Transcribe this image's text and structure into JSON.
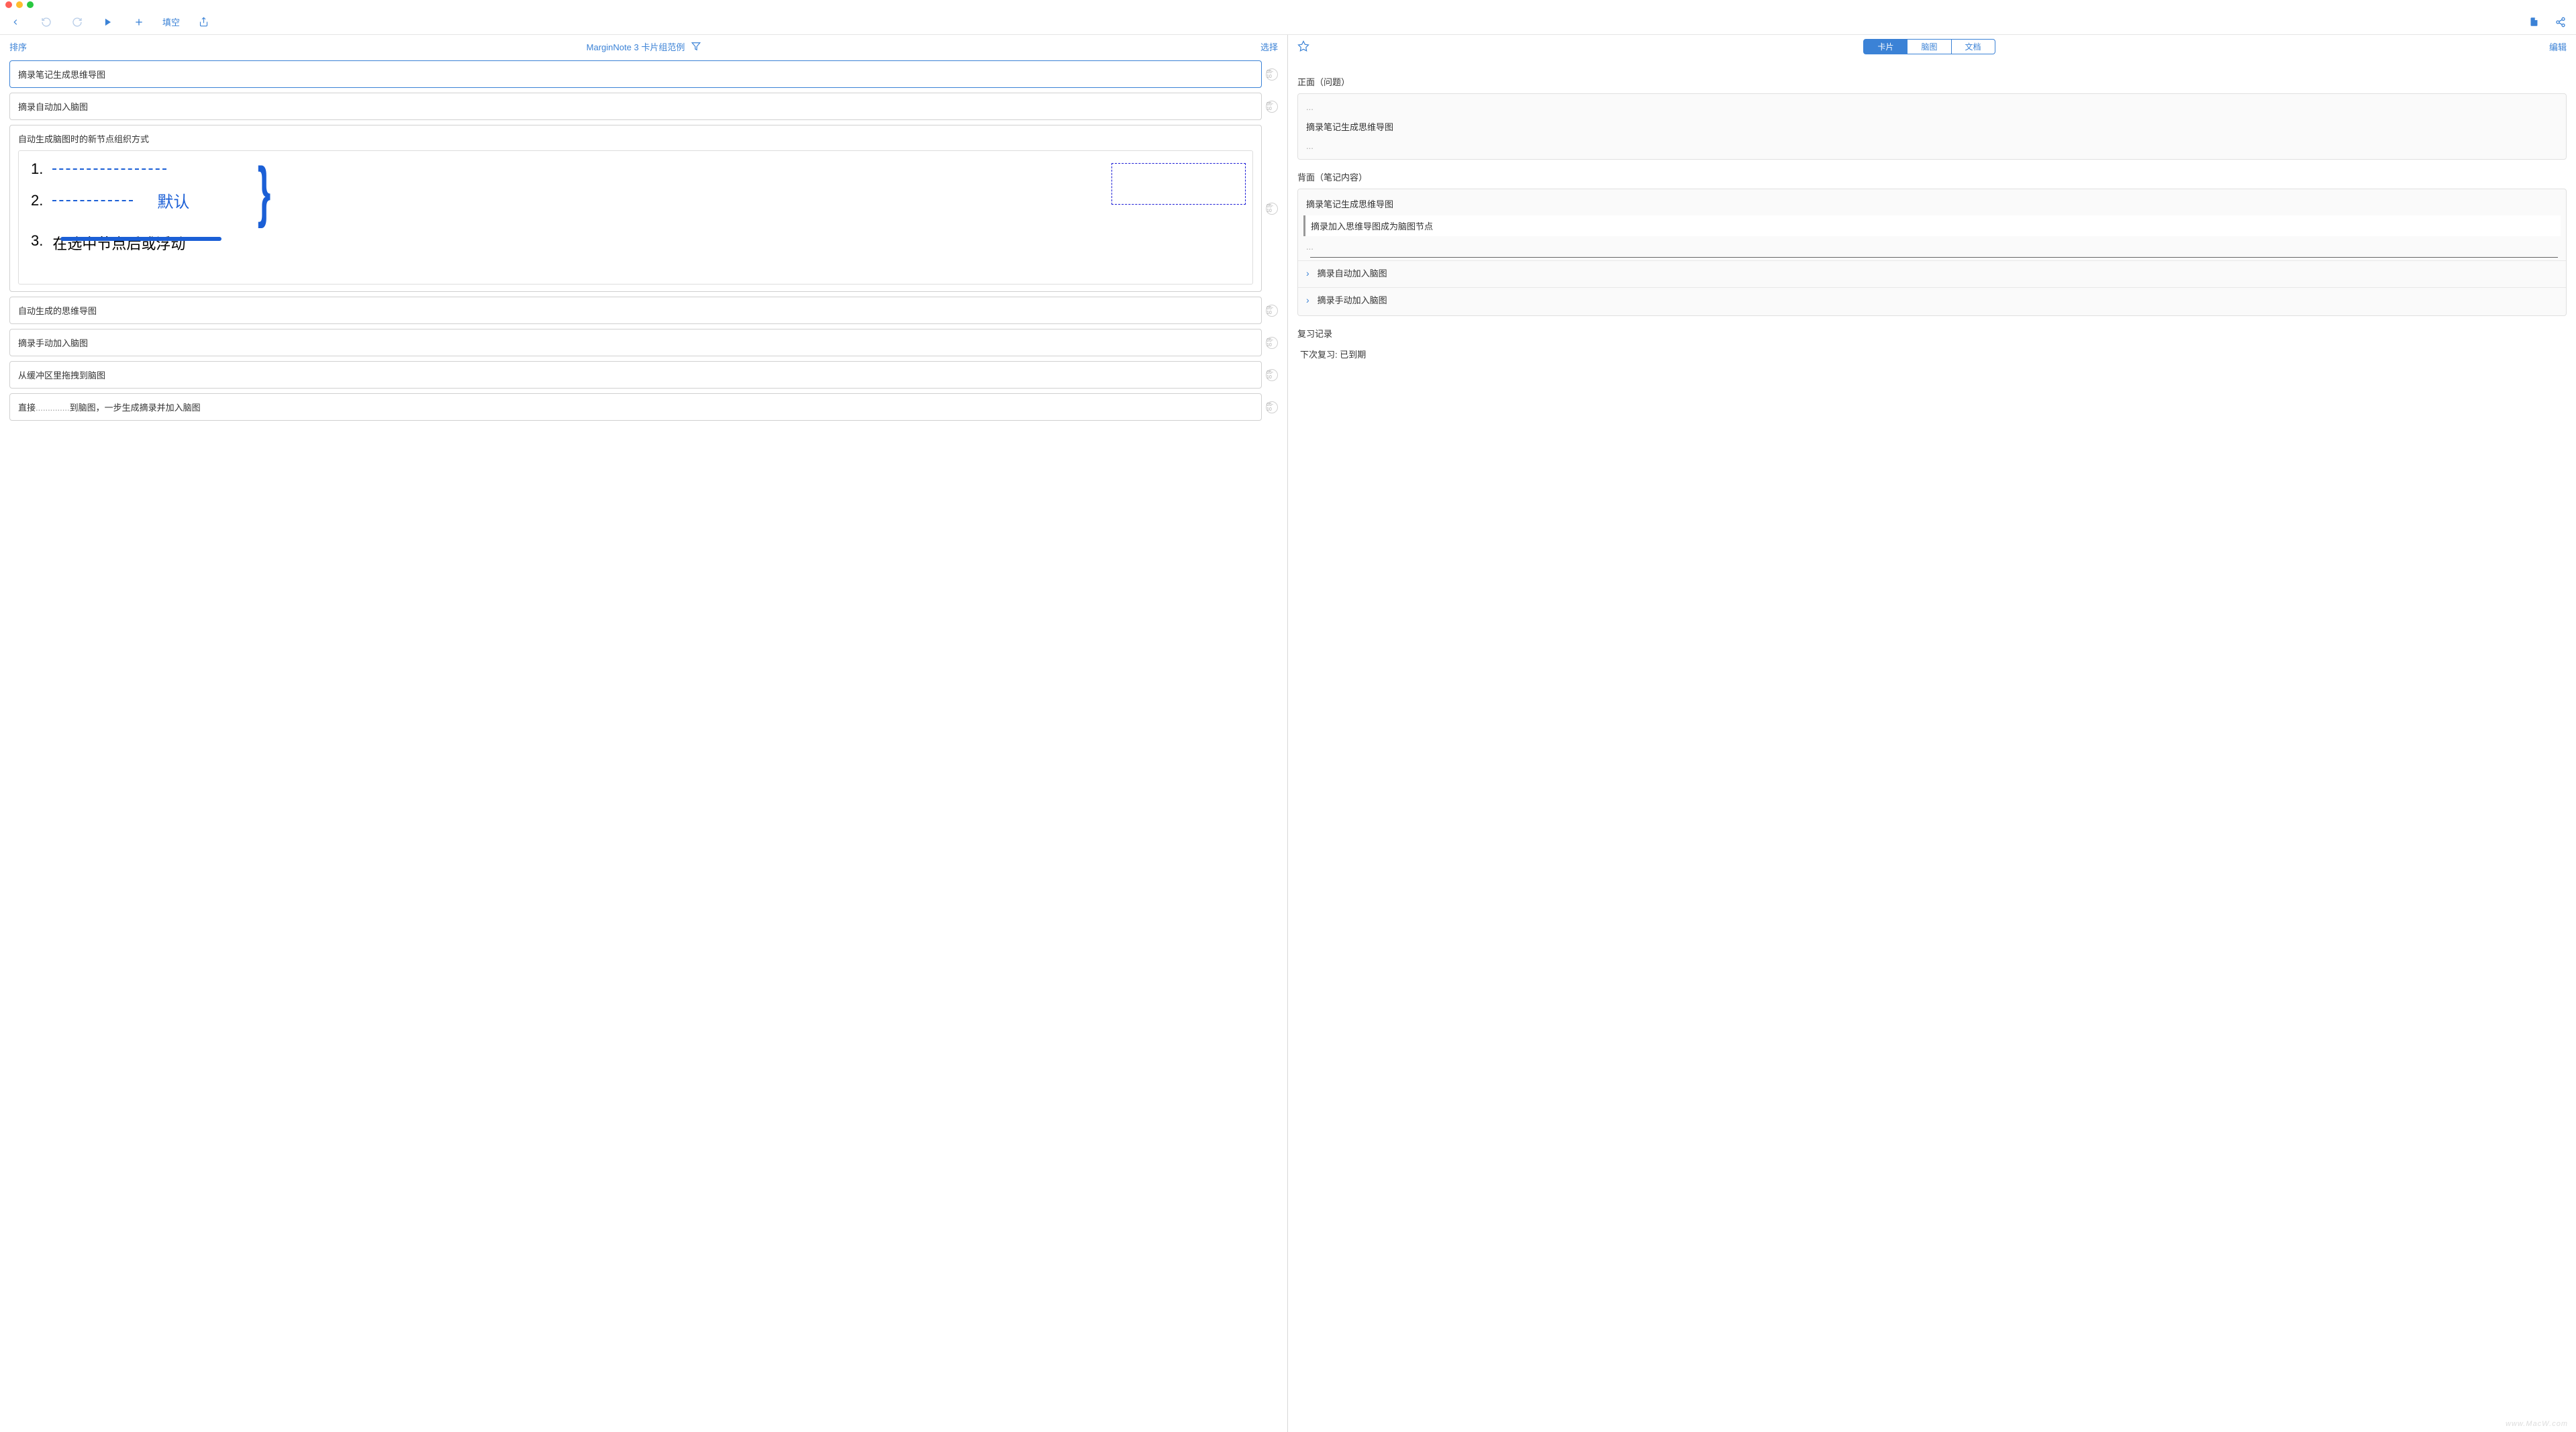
{
  "toolbar": {
    "fill_blank": "填空"
  },
  "left": {
    "sort": "排序",
    "title": "MarginNote 3 卡片组范例",
    "select": "选择",
    "badge": "05-10",
    "cards": {
      "c0": "摘录笔记生成思维导图",
      "c1": "摘录自动加入脑图",
      "c2": "自动生成脑图时的新节点组织方式",
      "c3": "自动生成的思维导图",
      "c4": "摘录手动加入脑图",
      "c5": "从缓冲区里拖拽到脑图",
      "c6_pre": "直接",
      "c6_post": "到脑图，一步生成摘录并加入脑图",
      "img_default": "默认",
      "img_item3": "在选中节点后或浮动"
    }
  },
  "right": {
    "tabs": {
      "card": "卡片",
      "mindmap": "脑图",
      "document": "文档"
    },
    "edit": "编辑",
    "front_label": "正面（问题）",
    "front_text": "摘录笔记生成思维导图",
    "dots": "...",
    "back_label": "背面（笔记内容）",
    "back_t1": "摘录笔记生成思维导图",
    "back_t2": "摘录加入思维导图成为脑图节点",
    "link1": "摘录自动加入脑图",
    "link2": "摘录手动加入脑图",
    "review_label": "复习记录",
    "review_text": "下次复习: 已到期"
  },
  "watermark": "www.MacW.com"
}
